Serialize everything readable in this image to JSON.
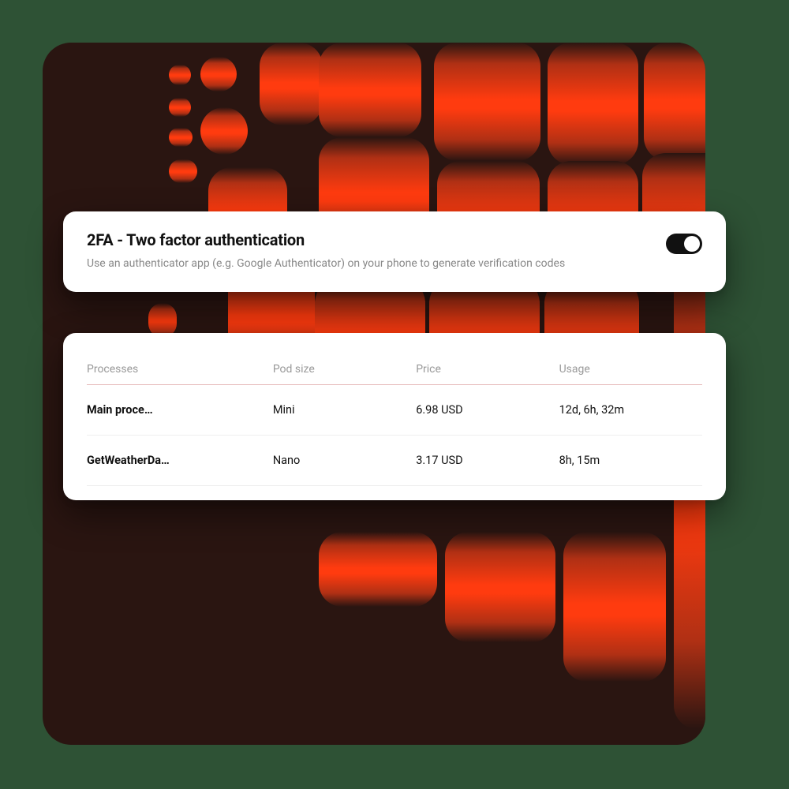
{
  "twofa": {
    "title": "2FA - Two factor authentication",
    "description": "Use an authenticator app (e.g. Google Authenticator) on your phone to generate verification codes",
    "enabled": true
  },
  "table": {
    "headers": {
      "processes": "Processes",
      "pod_size": "Pod size",
      "price": "Price",
      "usage": "Usage"
    },
    "rows": [
      {
        "name": "Main proce…",
        "pod_size": "Mini",
        "price": "6.98 USD",
        "usage": "12d, 6h, 32m"
      },
      {
        "name": "GetWeatherDa…",
        "pod_size": "Nano",
        "price": "3.17 USD",
        "usage": "8h, 15m"
      }
    ]
  }
}
